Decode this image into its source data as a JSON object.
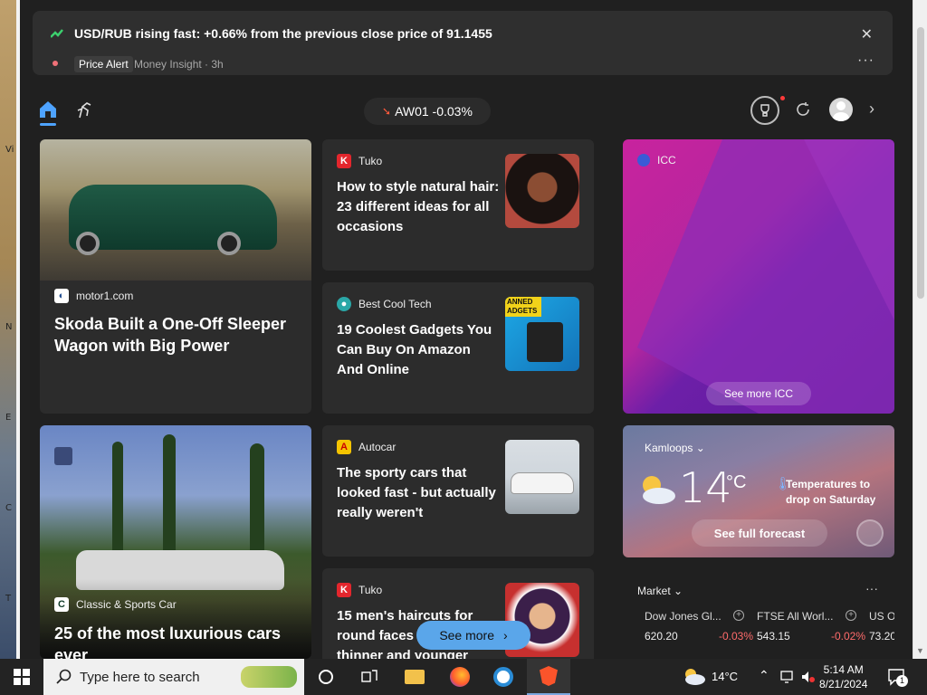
{
  "alert": {
    "title": "USD/RUB rising fast: +0.66% from the previous close price of 91.1455",
    "badge": "Price Alert",
    "source": "Money Insight · 3h"
  },
  "toolbar": {
    "stock_label": "AW01 -0.03%"
  },
  "cards": {
    "motor1": {
      "source": "motor1.com",
      "title": "Skoda Built a One-Off Sleeper Wagon with Big Power"
    },
    "tuko_hair": {
      "source": "Tuko",
      "title": "How to style natural hair: 23 different ideas for all occasions"
    },
    "icc": {
      "source": "ICC",
      "see_more": "See more ICC"
    },
    "gadgets": {
      "source": "Best Cool Tech",
      "title": "19 Coolest Gadgets You Can Buy On Amazon And Online",
      "thumb_text": "ANNED\nADGETS"
    },
    "autocar": {
      "source": "Autocar",
      "title": "The sporty cars that looked fast - but actually really weren't"
    },
    "classic": {
      "source": "Classic & Sports Car",
      "title": "25 of the most luxurious cars ever"
    },
    "tuko_hair2": {
      "source": "Tuko",
      "title": "15 men's haircuts for round faces to look thinner and younger"
    }
  },
  "weather": {
    "city": "Kamloops",
    "temp": "14",
    "unit": "°C",
    "note": "Temperatures to drop on Saturday",
    "forecast_button": "See full forecast"
  },
  "market": {
    "title": "Market",
    "items": [
      {
        "name": "Dow Jones Gl...",
        "value": "620.20",
        "change": "-0.03%"
      },
      {
        "name": "FTSE All Worl...",
        "value": "543.15",
        "change": "-0.02%"
      },
      {
        "name": "US O",
        "value": "73.20",
        "change": ""
      }
    ]
  },
  "see_more": "See more",
  "taskbar": {
    "search_placeholder": "Type here to search",
    "weather_temp": "14°C",
    "time": "5:14 AM",
    "date": "8/21/2024",
    "notification_count": "1"
  },
  "desktop_glyphs": [
    "Vi",
    "N",
    "E",
    "C",
    "T"
  ]
}
